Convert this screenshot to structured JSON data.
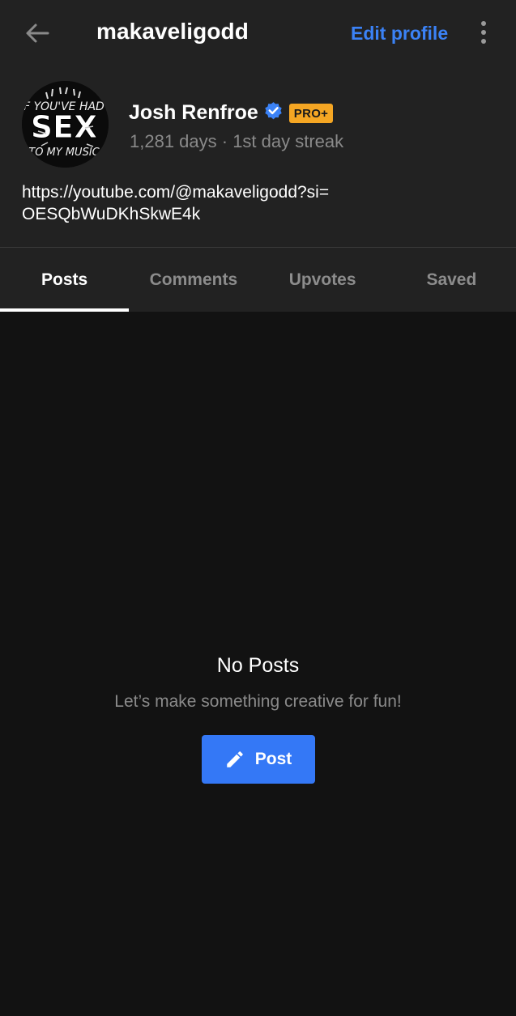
{
  "header": {
    "username": "makaveligodd",
    "edit_profile_label": "Edit profile"
  },
  "profile": {
    "display_name": "Josh Renfroe",
    "badge": "PRO+",
    "streak_text": "1,281 days · 1st day streak",
    "bio_line1": "https://youtube.com/@makaveligodd?si=",
    "bio_line2": "OESQbWuDKhSkwE4k",
    "avatar_text_top": "F YOU'VE HAD",
    "avatar_text_main": "SEX",
    "avatar_text_bottom": "TO MY MUSIC"
  },
  "tabs": [
    {
      "label": "Posts",
      "active": true
    },
    {
      "label": "Comments",
      "active": false
    },
    {
      "label": "Upvotes",
      "active": false
    },
    {
      "label": "Saved",
      "active": false
    }
  ],
  "empty_state": {
    "title": "No Posts",
    "subtitle": "Let’s make something creative for fun!",
    "button_label": "Post"
  },
  "colors": {
    "accent": "#3b82f6",
    "button": "#3478f6",
    "badge": "#f5a623",
    "header_bg": "#222222",
    "page_bg": "#121212"
  },
  "icons": {
    "back": "arrow-left-icon",
    "more": "more-vertical-icon",
    "verified": "verified-badge-icon",
    "post": "pencil-icon"
  }
}
